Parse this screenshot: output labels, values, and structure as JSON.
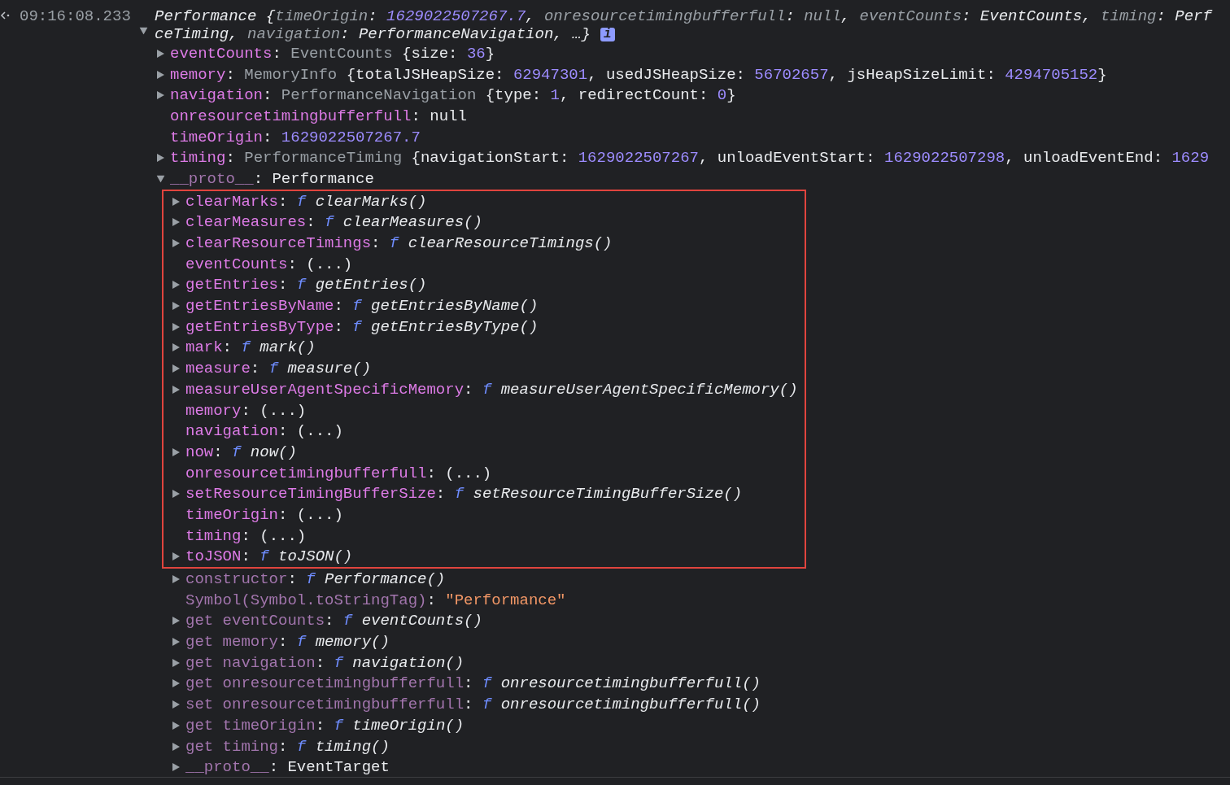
{
  "message": {
    "timestamp": "09:16:08.233",
    "expanded": true,
    "info_badge": "i",
    "summary_lines": [
      {
        "tokens": [
          {
            "kind": "plain",
            "text": "Performance"
          },
          {
            "kind": "plain",
            "text": " {"
          },
          {
            "kind": "dim",
            "text": "timeOrigin"
          },
          {
            "kind": "plain",
            "text": ": "
          },
          {
            "kind": "num",
            "text": "1629022507267.7"
          },
          {
            "kind": "plain",
            "text": ", "
          },
          {
            "kind": "dim",
            "text": "onresourcetimingbufferfull"
          },
          {
            "kind": "plain",
            "text": ": "
          },
          {
            "kind": "dim",
            "text": "null"
          },
          {
            "kind": "plain",
            "text": ", "
          },
          {
            "kind": "dim",
            "text": "eventCounts"
          },
          {
            "kind": "plain",
            "text": ": "
          },
          {
            "kind": "plain",
            "text": "EventCounts"
          },
          {
            "kind": "plain",
            "text": ", "
          },
          {
            "kind": "dim",
            "text": "timing"
          },
          {
            "kind": "plain",
            "text": ": "
          },
          {
            "kind": "plain",
            "text": "Perf"
          }
        ]
      },
      {
        "tokens": [
          {
            "kind": "plain",
            "text": "ceTiming"
          },
          {
            "kind": "plain",
            "text": ", "
          },
          {
            "kind": "dim",
            "text": "navigation"
          },
          {
            "kind": "plain",
            "text": ": "
          },
          {
            "kind": "plain",
            "text": "PerformanceNavigation"
          },
          {
            "kind": "plain",
            "text": ", …}"
          }
        ]
      }
    ],
    "properties": [
      {
        "key": "eventCounts",
        "kind": "own",
        "expandable": true,
        "expanded": false,
        "value": [
          {
            "kind": "plain",
            "text": ": "
          },
          {
            "kind": "dim",
            "text": "EventCounts"
          },
          {
            "kind": "plain",
            "text": " {size: "
          },
          {
            "kind": "num",
            "text": "36"
          },
          {
            "kind": "plain",
            "text": "}"
          }
        ]
      },
      {
        "key": "memory",
        "kind": "own",
        "expandable": true,
        "expanded": false,
        "value": [
          {
            "kind": "plain",
            "text": ": "
          },
          {
            "kind": "dim",
            "text": "MemoryInfo"
          },
          {
            "kind": "plain",
            "text": " {totalJSHeapSize: "
          },
          {
            "kind": "num",
            "text": "62947301"
          },
          {
            "kind": "plain",
            "text": ", usedJSHeapSize: "
          },
          {
            "kind": "num",
            "text": "56702657"
          },
          {
            "kind": "plain",
            "text": ", jsHeapSizeLimit: "
          },
          {
            "kind": "num",
            "text": "4294705152"
          },
          {
            "kind": "plain",
            "text": "}"
          }
        ]
      },
      {
        "key": "navigation",
        "kind": "own",
        "expandable": true,
        "expanded": false,
        "value": [
          {
            "kind": "plain",
            "text": ": "
          },
          {
            "kind": "dim",
            "text": "PerformanceNavigation"
          },
          {
            "kind": "plain",
            "text": " {type: "
          },
          {
            "kind": "num",
            "text": "1"
          },
          {
            "kind": "plain",
            "text": ", redirectCount: "
          },
          {
            "kind": "num",
            "text": "0"
          },
          {
            "kind": "plain",
            "text": "}"
          }
        ]
      },
      {
        "key": "onresourcetimingbufferfull",
        "kind": "own",
        "expandable": false,
        "value": [
          {
            "kind": "plain",
            "text": ": "
          },
          {
            "kind": "plain",
            "text": "null"
          }
        ]
      },
      {
        "key": "timeOrigin",
        "kind": "own",
        "expandable": false,
        "value": [
          {
            "kind": "plain",
            "text": ": "
          },
          {
            "kind": "num",
            "text": "1629022507267.7"
          }
        ]
      },
      {
        "key": "timing",
        "kind": "own",
        "expandable": true,
        "expanded": false,
        "value": [
          {
            "kind": "plain",
            "text": ": "
          },
          {
            "kind": "dim",
            "text": "PerformanceTiming"
          },
          {
            "kind": "plain",
            "text": " {navigationStart: "
          },
          {
            "kind": "num",
            "text": "1629022507267"
          },
          {
            "kind": "plain",
            "text": ", unloadEventStart: "
          },
          {
            "kind": "num",
            "text": "1629022507298"
          },
          {
            "kind": "plain",
            "text": ", unloadEventEnd: "
          },
          {
            "kind": "num",
            "text": "1629"
          }
        ]
      },
      {
        "key": "__proto__",
        "kind": "inherited",
        "expandable": true,
        "expanded": true,
        "value": [
          {
            "kind": "plain",
            "text": ": "
          },
          {
            "kind": "plain",
            "text": "Performance"
          }
        ],
        "children": [
          {
            "key": "clearMarks",
            "kind": "own",
            "expandable": true,
            "expanded": false,
            "highlighted": true,
            "value": [
              {
                "kind": "plain",
                "text": ": "
              },
              {
                "kind": "fn",
                "text": "f"
              },
              {
                "kind": "call",
                "text": " clearMarks()"
              }
            ]
          },
          {
            "key": "clearMeasures",
            "kind": "own",
            "expandable": true,
            "expanded": false,
            "highlighted": true,
            "value": [
              {
                "kind": "plain",
                "text": ": "
              },
              {
                "kind": "fn",
                "text": "f"
              },
              {
                "kind": "call",
                "text": " clearMeasures()"
              }
            ]
          },
          {
            "key": "clearResourceTimings",
            "kind": "own",
            "expandable": true,
            "expanded": false,
            "highlighted": true,
            "value": [
              {
                "kind": "plain",
                "text": ": "
              },
              {
                "kind": "fn",
                "text": "f"
              },
              {
                "kind": "call",
                "text": " clearResourceTimings()"
              }
            ]
          },
          {
            "key": "eventCounts",
            "kind": "own",
            "expandable": false,
            "highlighted": true,
            "value": [
              {
                "kind": "plain",
                "text": ": (...)"
              }
            ]
          },
          {
            "key": "getEntries",
            "kind": "own",
            "expandable": true,
            "expanded": false,
            "highlighted": true,
            "value": [
              {
                "kind": "plain",
                "text": ": "
              },
              {
                "kind": "fn",
                "text": "f"
              },
              {
                "kind": "call",
                "text": " getEntries()"
              }
            ]
          },
          {
            "key": "getEntriesByName",
            "kind": "own",
            "expandable": true,
            "expanded": false,
            "highlighted": true,
            "value": [
              {
                "kind": "plain",
                "text": ": "
              },
              {
                "kind": "fn",
                "text": "f"
              },
              {
                "kind": "call",
                "text": " getEntriesByName()"
              }
            ]
          },
          {
            "key": "getEntriesByType",
            "kind": "own",
            "expandable": true,
            "expanded": false,
            "highlighted": true,
            "value": [
              {
                "kind": "plain",
                "text": ": "
              },
              {
                "kind": "fn",
                "text": "f"
              },
              {
                "kind": "call",
                "text": " getEntriesByType()"
              }
            ]
          },
          {
            "key": "mark",
            "kind": "own",
            "expandable": true,
            "expanded": false,
            "highlighted": true,
            "value": [
              {
                "kind": "plain",
                "text": ": "
              },
              {
                "kind": "fn",
                "text": "f"
              },
              {
                "kind": "call",
                "text": " mark()"
              }
            ]
          },
          {
            "key": "measure",
            "kind": "own",
            "expandable": true,
            "expanded": false,
            "highlighted": true,
            "value": [
              {
                "kind": "plain",
                "text": ": "
              },
              {
                "kind": "fn",
                "text": "f"
              },
              {
                "kind": "call",
                "text": " measure()"
              }
            ]
          },
          {
            "key": "measureUserAgentSpecificMemory",
            "kind": "own",
            "expandable": true,
            "expanded": false,
            "highlighted": true,
            "value": [
              {
                "kind": "plain",
                "text": ": "
              },
              {
                "kind": "fn",
                "text": "f"
              },
              {
                "kind": "call",
                "text": " measureUserAgentSpecificMemory()"
              }
            ]
          },
          {
            "key": "memory",
            "kind": "own",
            "expandable": false,
            "highlighted": true,
            "value": [
              {
                "kind": "plain",
                "text": ": (...)"
              }
            ]
          },
          {
            "key": "navigation",
            "kind": "own",
            "expandable": false,
            "highlighted": true,
            "value": [
              {
                "kind": "plain",
                "text": ": (...)"
              }
            ]
          },
          {
            "key": "now",
            "kind": "own",
            "expandable": true,
            "expanded": false,
            "highlighted": true,
            "value": [
              {
                "kind": "plain",
                "text": ": "
              },
              {
                "kind": "fn",
                "text": "f"
              },
              {
                "kind": "call",
                "text": " now()"
              }
            ]
          },
          {
            "key": "onresourcetimingbufferfull",
            "kind": "own",
            "expandable": false,
            "highlighted": true,
            "value": [
              {
                "kind": "plain",
                "text": ": (...)"
              }
            ]
          },
          {
            "key": "setResourceTimingBufferSize",
            "kind": "own",
            "expandable": true,
            "expanded": false,
            "highlighted": true,
            "value": [
              {
                "kind": "plain",
                "text": ": "
              },
              {
                "kind": "fn",
                "text": "f"
              },
              {
                "kind": "call",
                "text": " setResourceTimingBufferSize()"
              }
            ]
          },
          {
            "key": "timeOrigin",
            "kind": "own",
            "expandable": false,
            "highlighted": true,
            "value": [
              {
                "kind": "plain",
                "text": ": (...)"
              }
            ]
          },
          {
            "key": "timing",
            "kind": "own",
            "expandable": false,
            "highlighted": true,
            "value": [
              {
                "kind": "plain",
                "text": ": (...)"
              }
            ]
          },
          {
            "key": "toJSON",
            "kind": "own",
            "expandable": true,
            "expanded": false,
            "highlighted": true,
            "value": [
              {
                "kind": "plain",
                "text": ": "
              },
              {
                "kind": "fn",
                "text": "f"
              },
              {
                "kind": "call",
                "text": " toJSON()"
              }
            ]
          },
          {
            "key": "constructor",
            "kind": "inherited",
            "expandable": true,
            "expanded": false,
            "highlighted": false,
            "value": [
              {
                "kind": "plain",
                "text": ": "
              },
              {
                "kind": "fn",
                "text": "f"
              },
              {
                "kind": "call",
                "text": " Performance()"
              }
            ]
          },
          {
            "key": "Symbol(Symbol.toStringTag)",
            "kind": "inherited",
            "expandable": false,
            "highlighted": false,
            "value": [
              {
                "kind": "plain",
                "text": ": "
              },
              {
                "kind": "str",
                "text": "\"Performance\""
              }
            ]
          },
          {
            "key": "get eventCounts",
            "kind": "inherited",
            "expandable": true,
            "expanded": false,
            "highlighted": false,
            "value": [
              {
                "kind": "plain",
                "text": ": "
              },
              {
                "kind": "fn",
                "text": "f"
              },
              {
                "kind": "call",
                "text": " eventCounts()"
              }
            ]
          },
          {
            "key": "get memory",
            "kind": "inherited",
            "expandable": true,
            "expanded": false,
            "highlighted": false,
            "value": [
              {
                "kind": "plain",
                "text": ": "
              },
              {
                "kind": "fn",
                "text": "f"
              },
              {
                "kind": "call",
                "text": " memory()"
              }
            ]
          },
          {
            "key": "get navigation",
            "kind": "inherited",
            "expandable": true,
            "expanded": false,
            "highlighted": false,
            "value": [
              {
                "kind": "plain",
                "text": ": "
              },
              {
                "kind": "fn",
                "text": "f"
              },
              {
                "kind": "call",
                "text": " navigation()"
              }
            ]
          },
          {
            "key": "get onresourcetimingbufferfull",
            "kind": "inherited",
            "expandable": true,
            "expanded": false,
            "highlighted": false,
            "value": [
              {
                "kind": "plain",
                "text": ": "
              },
              {
                "kind": "fn",
                "text": "f"
              },
              {
                "kind": "call",
                "text": " onresourcetimingbufferfull()"
              }
            ]
          },
          {
            "key": "set onresourcetimingbufferfull",
            "kind": "inherited",
            "expandable": true,
            "expanded": false,
            "highlighted": false,
            "value": [
              {
                "kind": "plain",
                "text": ": "
              },
              {
                "kind": "fn",
                "text": "f"
              },
              {
                "kind": "call",
                "text": " onresourcetimingbufferfull()"
              }
            ]
          },
          {
            "key": "get timeOrigin",
            "kind": "inherited",
            "expandable": true,
            "expanded": false,
            "highlighted": false,
            "value": [
              {
                "kind": "plain",
                "text": ": "
              },
              {
                "kind": "fn",
                "text": "f"
              },
              {
                "kind": "call",
                "text": " timeOrigin()"
              }
            ]
          },
          {
            "key": "get timing",
            "kind": "inherited",
            "expandable": true,
            "expanded": false,
            "highlighted": false,
            "value": [
              {
                "kind": "plain",
                "text": ": "
              },
              {
                "kind": "fn",
                "text": "f"
              },
              {
                "kind": "call",
                "text": " timing()"
              }
            ]
          },
          {
            "key": "__proto__",
            "kind": "inherited",
            "expandable": true,
            "expanded": false,
            "highlighted": false,
            "value": [
              {
                "kind": "plain",
                "text": ": "
              },
              {
                "kind": "plain",
                "text": "EventTarget"
              }
            ]
          }
        ]
      }
    ]
  }
}
